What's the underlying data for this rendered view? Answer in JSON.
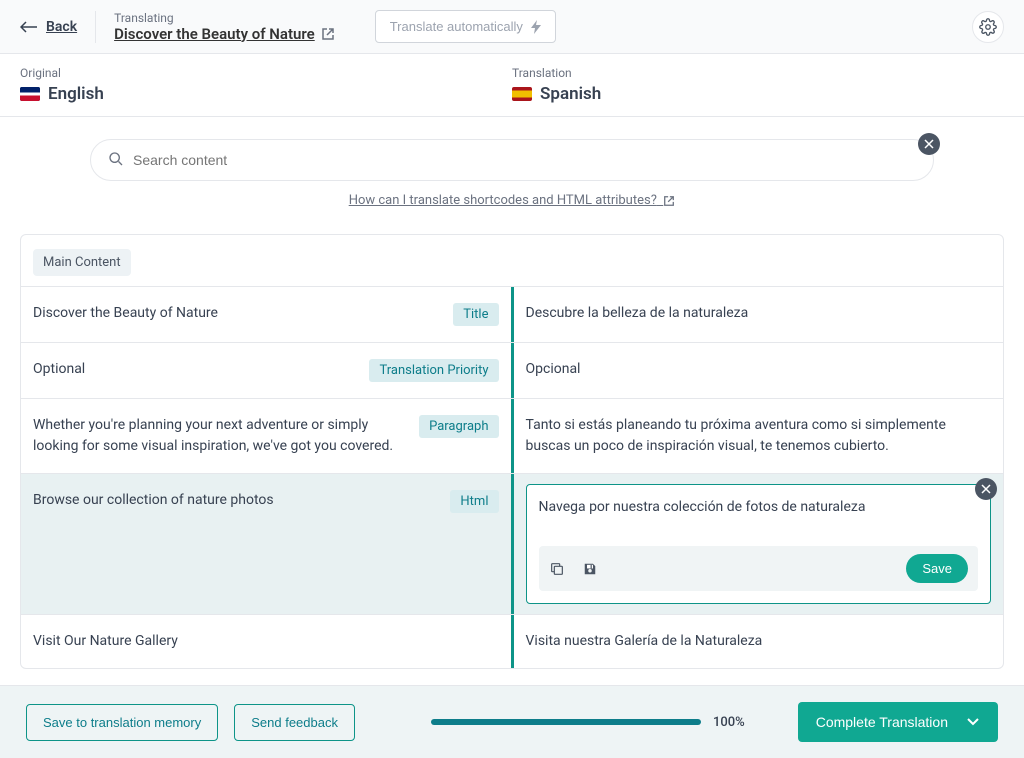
{
  "header": {
    "back": "Back",
    "translating_label": "Translating",
    "doc_title": "Discover the Beauty of Nature",
    "auto_btn": "Translate automatically"
  },
  "lang": {
    "original_label": "Original",
    "original_name": "English",
    "translation_label": "Translation",
    "translation_name": "Spanish"
  },
  "search": {
    "placeholder": "Search content",
    "help_text": "How can I translate shortcodes and HTML attributes?"
  },
  "section": {
    "title": "Main Content"
  },
  "rows": [
    {
      "source": "Discover the Beauty of Nature",
      "type": "Title",
      "target": "Descubre la belleza de la naturaleza"
    },
    {
      "source": "Optional",
      "type": "Translation Priority",
      "target": "Opcional"
    },
    {
      "source": "Whether you're planning your next adventure or simply looking for some visual inspiration, we've got you covered.",
      "type": "Paragraph",
      "target": "Tanto si estás planeando tu próxima aventura como si simplemente buscas un poco de inspiración visual, te tenemos cubierto."
    },
    {
      "source": "Browse our collection of nature photos",
      "type": "Html",
      "target": "Navega por nuestra colección de fotos de naturaleza"
    },
    {
      "source": "Visit Our Nature Gallery",
      "type": "",
      "target": "Visita nuestra Galería de la Naturaleza"
    }
  ],
  "editor": {
    "save": "Save"
  },
  "footer": {
    "save_mem": "Save to translation memory",
    "feedback": "Send feedback",
    "pct": "100%",
    "complete": "Complete Translation"
  }
}
